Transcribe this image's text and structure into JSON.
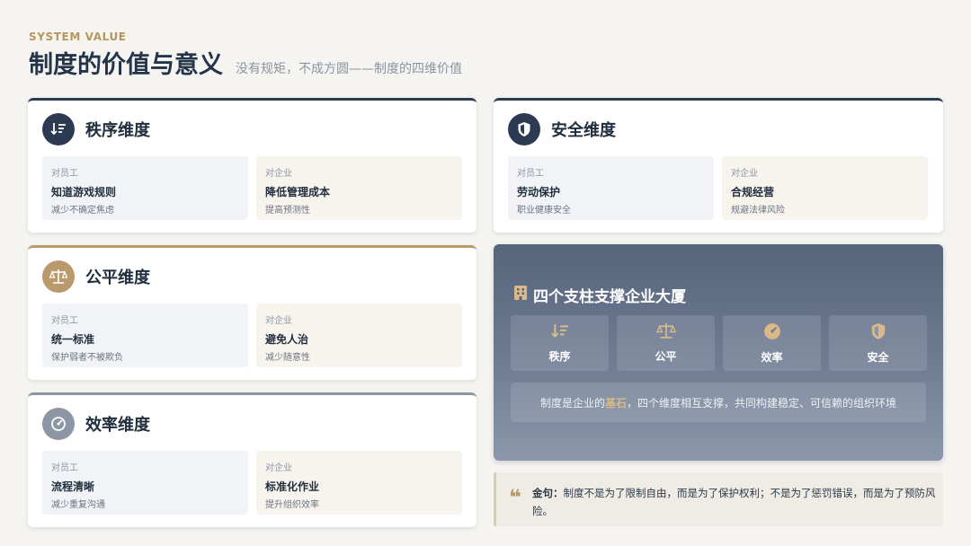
{
  "header": {
    "eyebrow": "SYSTEM VALUE",
    "title": "制度的价值与意义",
    "subtitle": "没有规矩，不成方圆——制度的四维价值"
  },
  "cards": {
    "order": {
      "title": "秩序维度",
      "icon": "sort-icon",
      "employee": {
        "label": "对员工",
        "main": "知道游戏规则",
        "sub": "减少不确定焦虑"
      },
      "company": {
        "label": "对企业",
        "main": "降低管理成本",
        "sub": "提高预测性"
      }
    },
    "fairness": {
      "title": "公平维度",
      "icon": "scale-icon",
      "employee": {
        "label": "对员工",
        "main": "统一标准",
        "sub": "保护弱者不被欺负"
      },
      "company": {
        "label": "对企业",
        "main": "避免人治",
        "sub": "减少随意性"
      }
    },
    "efficiency": {
      "title": "效率维度",
      "icon": "gauge-icon",
      "employee": {
        "label": "对员工",
        "main": "流程清晰",
        "sub": "减少重复沟通"
      },
      "company": {
        "label": "对企业",
        "main": "标准化作业",
        "sub": "提升组织效率"
      }
    },
    "safety": {
      "title": "安全维度",
      "icon": "shield-icon",
      "employee": {
        "label": "对员工",
        "main": "劳动保护",
        "sub": "职业健康安全"
      },
      "company": {
        "label": "对企业",
        "main": "合规经营",
        "sub": "规避法律风险"
      }
    }
  },
  "hero": {
    "title": "四个支柱支撑企业大厦",
    "icon": "building-icon",
    "pillars": [
      {
        "label": "秩序",
        "icon": "sort-icon"
      },
      {
        "label": "公平",
        "icon": "scale-icon"
      },
      {
        "label": "效率",
        "icon": "gauge-icon"
      },
      {
        "label": "安全",
        "icon": "shield-icon"
      }
    ],
    "note_before": "制度是企业的",
    "note_highlight": "基石",
    "note_after": "，四个维度相互支撑，共同构建稳定、可信赖的组织环境"
  },
  "quote": {
    "key": "金句：",
    "text": "制度不是为了限制自由，而是为了保护权利；不是为了惩罚错误，而是为了预防风险。"
  },
  "colors": {
    "navy": "#2c3a52",
    "gold": "#b99a6c",
    "gray": "#8d96a5",
    "accent_text": "#b6965f"
  }
}
